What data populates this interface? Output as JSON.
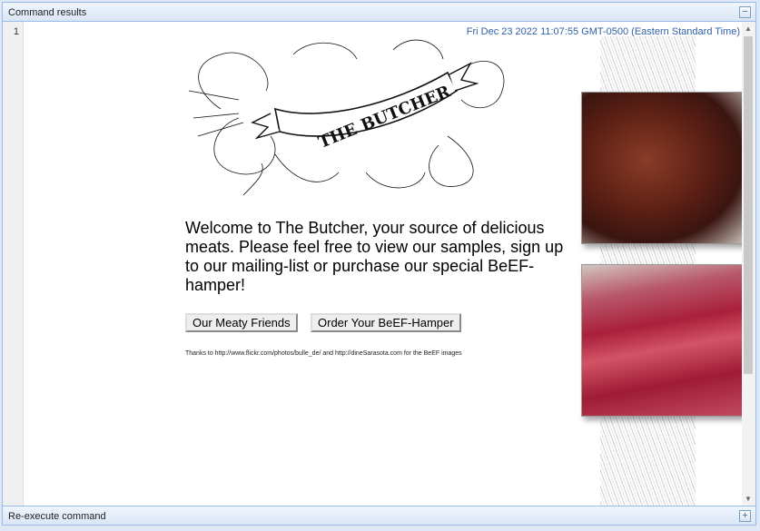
{
  "panel": {
    "title": "Command results",
    "collapse_symbol": "−"
  },
  "editor": {
    "line_number": "1",
    "timestamp": "Fri Dec 23 2022 11:07:55 GMT-0500 (Eastern Standard Time)"
  },
  "page": {
    "logo_text": "THE BUTCHER",
    "welcome": "Welcome to The Butcher, your source of delicious meats. Please feel free to view our samples, sign up to our mailing-list or purchase our special BeEF-hamper!",
    "buttons": {
      "friends": "Our Meaty Friends",
      "order": "Order Your BeEF-Hamper"
    },
    "thanks": "Thanks to http://www.flickr.com/photos/bulle_de/ and http://dineSarasota.com for the BeEF images"
  },
  "footer": {
    "title": "Re-execute command",
    "expand_symbol": "+"
  },
  "colors": {
    "panel_border": "#99bbe8",
    "timestamp": "#3060a8"
  }
}
